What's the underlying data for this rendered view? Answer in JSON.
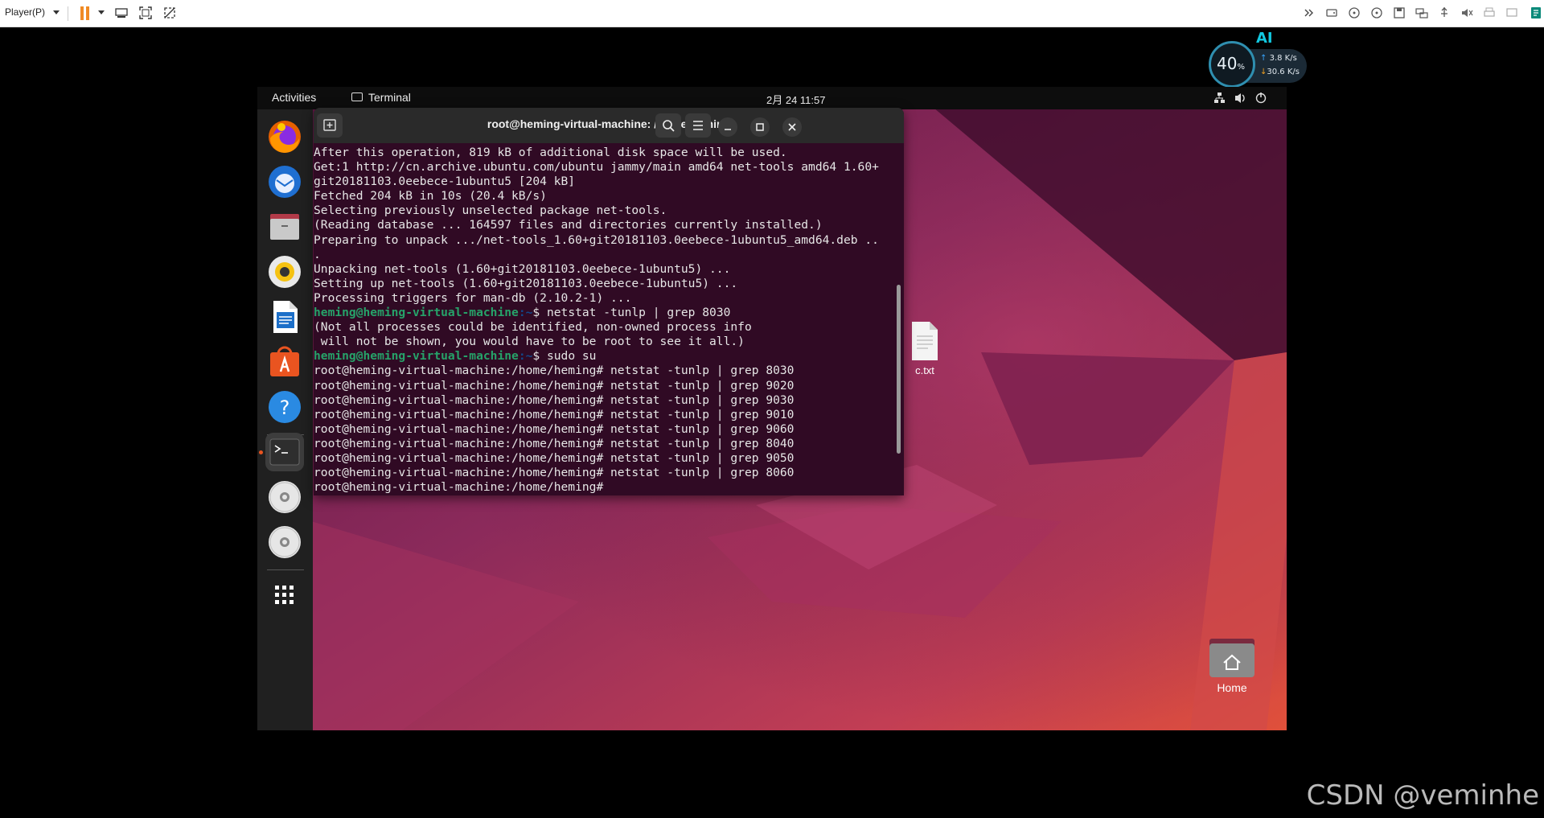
{
  "vm_toolbar": {
    "player_menu": "Player(P)"
  },
  "net_monitor": {
    "badge": "AI",
    "cpu_percent": "40",
    "percent_sign": "%",
    "upload": "3.8",
    "upload_unit": "K/s",
    "download": "30.6",
    "download_unit": "K/s"
  },
  "ubuntu": {
    "activities": "Activities",
    "app_name": "Terminal",
    "clock": "2月 24  11:57",
    "terminal": {
      "title": "root@heming-virtual-machine: /home/heming",
      "lines": [
        {
          "text": "After this operation, 819 kB of additional disk space will be used."
        },
        {
          "text": "Get:1 http://cn.archive.ubuntu.com/ubuntu jammy/main amd64 net-tools amd64 1.60+"
        },
        {
          "text": "git20181103.0eebece-1ubuntu5 [204 kB]"
        },
        {
          "text": "Fetched 204 kB in 10s (20.4 kB/s)"
        },
        {
          "text": "Selecting previously unselected package net-tools."
        },
        {
          "text": "(Reading database ... 164597 files and directories currently installed.)"
        },
        {
          "text": "Preparing to unpack .../net-tools_1.60+git20181103.0eebece-1ubuntu5_amd64.deb .."
        },
        {
          "text": "."
        },
        {
          "text": "Unpacking net-tools (1.60+git20181103.0eebece-1ubuntu5) ..."
        },
        {
          "text": "Setting up net-tools (1.60+git20181103.0eebece-1ubuntu5) ..."
        },
        {
          "text": "Processing triggers for man-db (2.10.2-1) ..."
        },
        {
          "user": "heming@heming-virtual-machine",
          "path": ":~",
          "text": "$ netstat -tunlp | grep 8030"
        },
        {
          "text": "(Not all processes could be identified, non-owned process info"
        },
        {
          "text": " will not be shown, you would have to be root to see it all.)"
        },
        {
          "user": "heming@heming-virtual-machine",
          "path": ":~",
          "text": "$ sudo su"
        },
        {
          "text": "root@heming-virtual-machine:/home/heming# netstat -tunlp | grep 8030"
        },
        {
          "text": "root@heming-virtual-machine:/home/heming# netstat -tunlp | grep 9020"
        },
        {
          "text": "root@heming-virtual-machine:/home/heming# netstat -tunlp | grep 9030"
        },
        {
          "text": "root@heming-virtual-machine:/home/heming# netstat -tunlp | grep 9010"
        },
        {
          "text": "root@heming-virtual-machine:/home/heming# netstat -tunlp | grep 9060"
        },
        {
          "text": "root@heming-virtual-machine:/home/heming# netstat -tunlp | grep 8040"
        },
        {
          "text": "root@heming-virtual-machine:/home/heming# netstat -tunlp | grep 9050"
        },
        {
          "text": "root@heming-virtual-machine:/home/heming# netstat -tunlp | grep 8060"
        },
        {
          "text": "root@heming-virtual-machine:/home/heming# "
        }
      ]
    },
    "desktop": {
      "file_label": "c.txt",
      "home_label": "Home"
    },
    "dock_icons": [
      "firefox-icon",
      "thunderbird-icon",
      "files-icon",
      "rhythmbox-icon",
      "libreoffice-writer-icon",
      "app-center-icon",
      "help-icon",
      "terminal-icon",
      "dvd-icon",
      "dvd-icon",
      "show-apps-icon"
    ]
  },
  "watermark": "CSDN @veminhe",
  "colors": {
    "terminal_bg": "#300a24",
    "prompt_green": "#26a269",
    "prompt_blue": "#12488b",
    "ubuntu_orange": "#e95420"
  }
}
